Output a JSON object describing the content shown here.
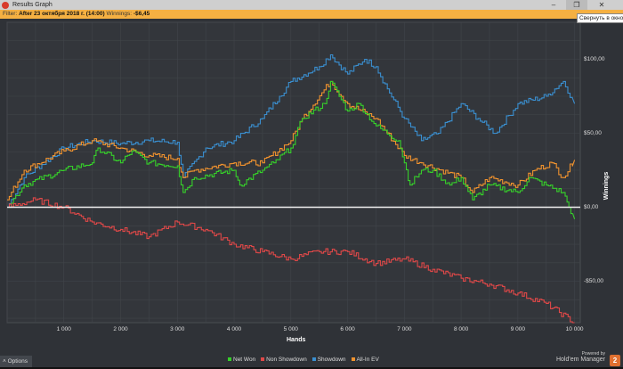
{
  "window": {
    "title": "Results Graph",
    "tooltip": "Свернуть в окно",
    "minimize": "–",
    "restore": "❐",
    "close": "✕"
  },
  "filter": {
    "label": "Filter:",
    "value": "After 23 октября 2018 г. (14:00)",
    "winnings_label": "Winnings:",
    "winnings_value": "-$6,45"
  },
  "chart_data": {
    "type": "line",
    "xlabel": "Hands",
    "ylabel": "Winnings",
    "xlim": [
      0,
      10100
    ],
    "ylim": [
      -78,
      125
    ],
    "x_ticks": [
      {
        "v": 1000,
        "label": "1 000"
      },
      {
        "v": 2000,
        "label": "2 000"
      },
      {
        "v": 3000,
        "label": "3 000"
      },
      {
        "v": 4000,
        "label": "4 000"
      },
      {
        "v": 5000,
        "label": "5 000"
      },
      {
        "v": 6000,
        "label": "6 000"
      },
      {
        "v": 7000,
        "label": "7 000"
      },
      {
        "v": 8000,
        "label": "8 000"
      },
      {
        "v": 9000,
        "label": "9 000"
      },
      {
        "v": 10000,
        "label": "10 000"
      }
    ],
    "y_ticks": [
      {
        "v": 100,
        "label": "$100,00"
      },
      {
        "v": 50,
        "label": "$50,00"
      },
      {
        "v": 0,
        "label": "$0,00"
      },
      {
        "v": -50,
        "label": "-$50,00"
      }
    ],
    "legend_position": "bottom",
    "series": [
      {
        "name": "Showdown",
        "color": "#3a8fd0",
        "points": [
          [
            0,
            0
          ],
          [
            300,
            20
          ],
          [
            1000,
            40
          ],
          [
            1500,
            45
          ],
          [
            2000,
            43
          ],
          [
            2500,
            45
          ],
          [
            3000,
            44
          ],
          [
            3100,
            20
          ],
          [
            3500,
            40
          ],
          [
            4000,
            45
          ],
          [
            4500,
            60
          ],
          [
            4800,
            75
          ],
          [
            5000,
            85
          ],
          [
            5500,
            95
          ],
          [
            5700,
            103
          ],
          [
            6000,
            90
          ],
          [
            6300,
            100
          ],
          [
            6500,
            95
          ],
          [
            6700,
            80
          ],
          [
            7000,
            60
          ],
          [
            7300,
            45
          ],
          [
            7600,
            50
          ],
          [
            8000,
            70
          ],
          [
            8300,
            60
          ],
          [
            8600,
            50
          ],
          [
            9000,
            70
          ],
          [
            9500,
            75
          ],
          [
            9800,
            85
          ],
          [
            10000,
            70
          ]
        ]
      },
      {
        "name": "All-In EV",
        "color": "#f0922e",
        "points": [
          [
            0,
            5
          ],
          [
            300,
            25
          ],
          [
            1000,
            38
          ],
          [
            1500,
            45
          ],
          [
            2000,
            40
          ],
          [
            2500,
            35
          ],
          [
            3000,
            33
          ],
          [
            3100,
            20
          ],
          [
            3300,
            25
          ],
          [
            4000,
            30
          ],
          [
            4500,
            30
          ],
          [
            5000,
            45
          ],
          [
            5200,
            60
          ],
          [
            5700,
            85
          ],
          [
            6000,
            70
          ],
          [
            6500,
            60
          ],
          [
            7000,
            35
          ],
          [
            7300,
            30
          ],
          [
            8000,
            20
          ],
          [
            8200,
            10
          ],
          [
            8500,
            20
          ],
          [
            9000,
            15
          ],
          [
            9300,
            25
          ],
          [
            9600,
            30
          ],
          [
            9800,
            20
          ],
          [
            10000,
            32
          ]
        ]
      },
      {
        "name": "Net Won",
        "color": "#36d02a",
        "points": [
          [
            0,
            0
          ],
          [
            300,
            15
          ],
          [
            1000,
            25
          ],
          [
            1500,
            30
          ],
          [
            1600,
            40
          ],
          [
            2000,
            30
          ],
          [
            2200,
            38
          ],
          [
            2500,
            30
          ],
          [
            3000,
            28
          ],
          [
            3100,
            10
          ],
          [
            3300,
            20
          ],
          [
            4000,
            25
          ],
          [
            4100,
            15
          ],
          [
            4500,
            25
          ],
          [
            4700,
            30
          ],
          [
            5000,
            40
          ],
          [
            5200,
            60
          ],
          [
            5600,
            70
          ],
          [
            5700,
            85
          ],
          [
            6000,
            65
          ],
          [
            6200,
            70
          ],
          [
            6500,
            55
          ],
          [
            6900,
            45
          ],
          [
            7000,
            30
          ],
          [
            7100,
            15
          ],
          [
            7300,
            25
          ],
          [
            7500,
            25
          ],
          [
            7800,
            15
          ],
          [
            8000,
            20
          ],
          [
            8200,
            5
          ],
          [
            8500,
            15
          ],
          [
            9000,
            10
          ],
          [
            9200,
            20
          ],
          [
            9500,
            15
          ],
          [
            9800,
            10
          ],
          [
            9900,
            0
          ],
          [
            10000,
            -8
          ]
        ]
      },
      {
        "name": "Non Showdown",
        "color": "#e04848",
        "points": [
          [
            0,
            0
          ],
          [
            500,
            5
          ],
          [
            1000,
            0
          ],
          [
            1500,
            -10
          ],
          [
            2000,
            -15
          ],
          [
            2500,
            -20
          ],
          [
            3000,
            -10
          ],
          [
            3500,
            -15
          ],
          [
            4000,
            -25
          ],
          [
            4500,
            -30
          ],
          [
            5000,
            -35
          ],
          [
            5500,
            -30
          ],
          [
            6000,
            -30
          ],
          [
            6500,
            -38
          ],
          [
            7000,
            -35
          ],
          [
            7500,
            -42
          ],
          [
            8000,
            -48
          ],
          [
            8500,
            -52
          ],
          [
            9000,
            -58
          ],
          [
            9500,
            -65
          ],
          [
            10000,
            -78
          ]
        ]
      }
    ]
  },
  "legend": [
    {
      "label": "Net Won",
      "color": "#36d02a"
    },
    {
      "label": "Non Showdown",
      "color": "#e04848"
    },
    {
      "label": "Showdown",
      "color": "#3a8fd0"
    },
    {
      "label": "All-In EV",
      "color": "#f0922e"
    }
  ],
  "options": {
    "label": "˄  Options"
  },
  "branding": {
    "powered": "Powered by",
    "product": "Hold'em Manager",
    "logo": "2"
  }
}
